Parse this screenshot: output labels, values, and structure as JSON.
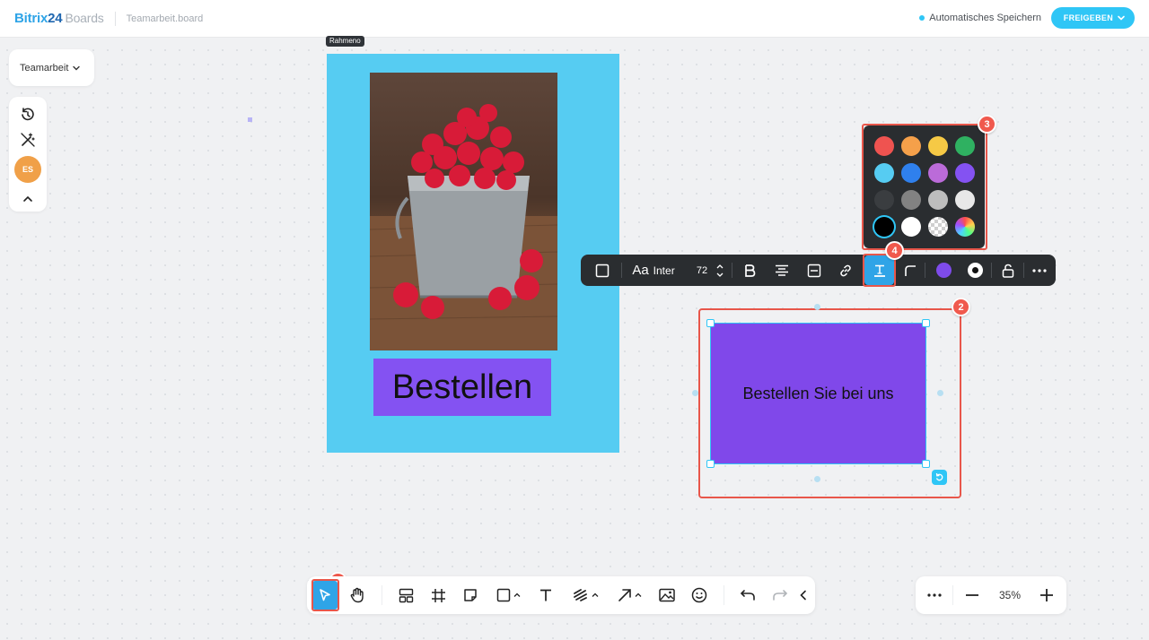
{
  "header": {
    "brand_main": "Bitrix",
    "brand_num": "24",
    "brand_product": "Boards",
    "file_name": "Teamarbeit.board",
    "autosave_text": "Automatisches Speichern",
    "share_label": "FREIGEBEN"
  },
  "left_panel": {
    "board_name": "Teamarbeit",
    "avatar_initials": "ES"
  },
  "canvas": {
    "frame_label": "Rahmeno",
    "button_text": "Bestellen",
    "shape_text": "Bestellen Sie bei uns"
  },
  "context_toolbar": {
    "font_icon": "Aa",
    "font_name": "Inter",
    "font_size": "72",
    "shape_color": "#7e4bea"
  },
  "color_picker": {
    "swatches": [
      "#ef5350",
      "#f5a04a",
      "#f6c945",
      "#2fb161",
      "#56ccf2",
      "#2f80ed",
      "#bb6bd9",
      "#8452f2",
      "#3a3d40",
      "#828282",
      "#bdbdbd",
      "#e8e8e8",
      "#000000",
      "#ffffff",
      "transparent",
      "gradient"
    ]
  },
  "badges": [
    "1",
    "2",
    "3",
    "4"
  ],
  "zoom": {
    "value": "35%"
  },
  "colors": {
    "accent": "#2fc6f6",
    "frame": "#56ccf2",
    "purple": "#8452f2",
    "highlight": "#e8564a"
  }
}
